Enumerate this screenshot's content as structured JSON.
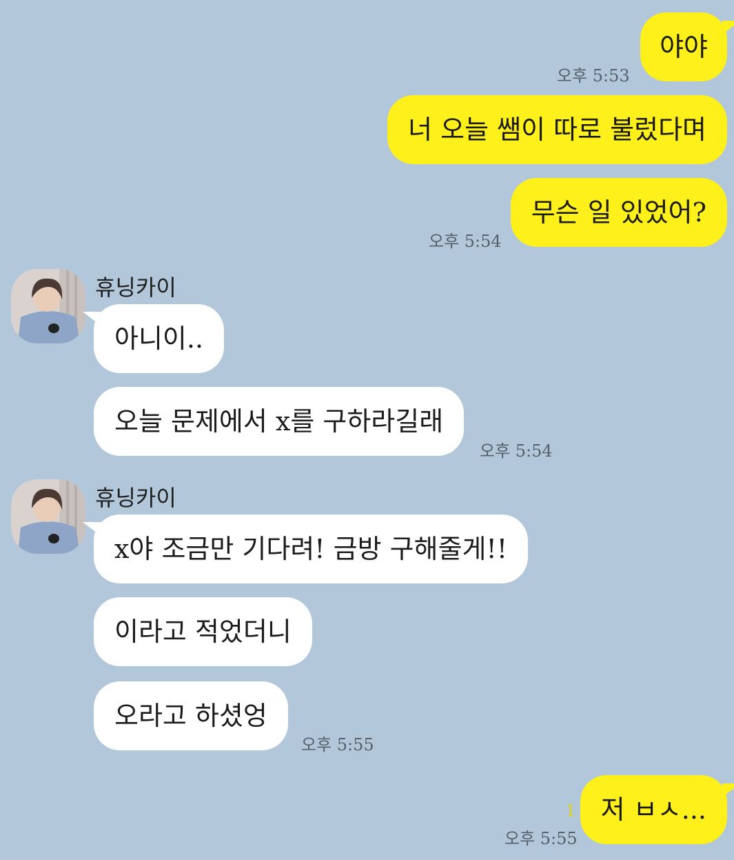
{
  "messages_out_1": {
    "m1": "야야",
    "m1_time": "오후 5:53",
    "m2": "너 오늘 쌤이 따로 불렀다며",
    "m3": "무슨 일 있었어?",
    "m3_time": "오후 5:54"
  },
  "group_in_1": {
    "sender": "휴닝카이",
    "m1": "아니이..",
    "m2": "오늘 문제에서 x를 구하라길래",
    "m2_time": "오후 5:54"
  },
  "group_in_2": {
    "sender": "휴닝카이",
    "m1": "x야 조금만 기다려! 금방 구해줄게!!",
    "m2": "이라고 적었더니",
    "m3": "오라고 하셨엉",
    "m3_time": "오후 5:55"
  },
  "messages_out_2": {
    "m1": "저 ㅂㅅ...",
    "unread": "1",
    "m1_time": "오후 5:55"
  },
  "colors": {
    "background": "#b2c7da",
    "my_bubble": "#fef01b",
    "their_bubble": "#ffffff",
    "unread_count": "#ead300"
  }
}
